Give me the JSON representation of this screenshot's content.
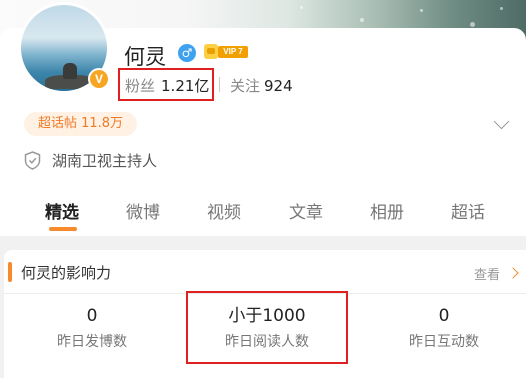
{
  "profile": {
    "name": "何灵",
    "gender_symbol": "♂",
    "vip_label": "VIP 7",
    "verified_badge": "V",
    "fans_label": "粉丝",
    "fans_value": "1.21亿",
    "follow_label": "关注",
    "follow_value": "924",
    "super_topic": "超话帖 11.8万",
    "verification": "湖南卫视主持人"
  },
  "tabs": [
    "精选",
    "微博",
    "视频",
    "文章",
    "相册",
    "超话"
  ],
  "active_tab": "精选",
  "influence": {
    "title": "何灵的影响力",
    "more_label": "查看",
    "stats": [
      {
        "value": "0",
        "label": "昨日发博数"
      },
      {
        "value": "小于1000",
        "label": "昨日阅读人数"
      },
      {
        "value": "0",
        "label": "昨日互动数"
      }
    ]
  },
  "colors": {
    "accent_orange": "#f78a2d",
    "highlight_red": "#e02020",
    "gender_blue": "#3ea2f0",
    "vip_gold": "#f2a000"
  },
  "icons": [
    "gender-male-icon",
    "vip-crown-icon",
    "verified-v-icon",
    "chevron-down-icon",
    "shield-icon",
    "chevron-right-icon"
  ]
}
